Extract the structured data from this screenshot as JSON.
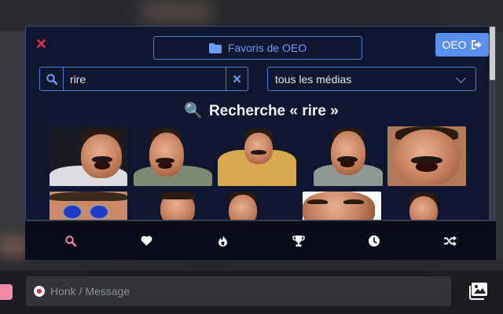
{
  "popup": {
    "close_icon": "times-icon",
    "favorites_label": "Favoris de OEO",
    "account_label": "OEO",
    "search": {
      "value": "rire",
      "placeholder": ""
    },
    "media_filter": {
      "selected": "tous les médias"
    },
    "results_title_icon": "🔍",
    "results_title": "Recherche « rire »",
    "accent_color": "#5b8fef",
    "close_color": "#e0354a",
    "results": [
      {
        "label": "laughing-man-1"
      },
      {
        "label": "laughing-man-2"
      },
      {
        "label": "laughing-man-3"
      },
      {
        "label": "laughing-man-4"
      },
      {
        "label": "laughing-man-5"
      },
      {
        "label": "laughing-man-6"
      },
      {
        "label": "laughing-man-7"
      },
      {
        "label": "laughing-man-8"
      },
      {
        "label": "laughing-man-9"
      },
      {
        "label": "laughing-man-10"
      }
    ]
  },
  "tabs": [
    {
      "icon": "search-icon",
      "active": true,
      "color": "#f08aa8"
    },
    {
      "icon": "heart-icon",
      "active": false
    },
    {
      "icon": "fire-icon",
      "active": false
    },
    {
      "icon": "trophy-icon",
      "active": false
    },
    {
      "icon": "clock-icon",
      "active": false
    },
    {
      "icon": "shuffle-icon",
      "active": false
    }
  ],
  "composer": {
    "placeholder": "Honk / Message"
  }
}
